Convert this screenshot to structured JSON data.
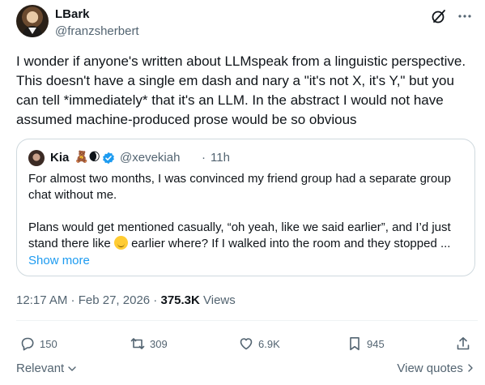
{
  "author": {
    "display_name": "LBark",
    "handle": "@franzsherbert"
  },
  "icons": {
    "grok": "grok-icon",
    "more": "more-horizontal-icon"
  },
  "tweet": {
    "text": "I wonder if anyone's written about LLMspeak from a linguistic perspective. This doesn't have a single em dash and nary a \"it's not X, it's Y,\" but you can tell *immediately* that it's an LLM. In the abstract I would not have assumed machine-produced prose would be so obvious"
  },
  "quote": {
    "name": "Kia",
    "name_emoji": "🧸🌒",
    "handle": "@xevekiah",
    "separator": "·",
    "time": "11h",
    "text_line1": "For almost two months, I was convinced my friend group had a separate group chat without me.",
    "text_line2a": "Plans would get mentioned casually, “oh yeah, like we said earlier”, and I’d just stand there like ",
    "text_line2b": " earlier where? If I walked into the room and they stopped ...",
    "show_more": "Show more"
  },
  "meta": {
    "time": "12:17 AM",
    "sep1": " · ",
    "date": "Feb 27, 2026",
    "sep2": " · ",
    "views_count": "375.3K",
    "views_label": " Views"
  },
  "actions": {
    "replies": "150",
    "reposts": "309",
    "likes": "6.9K",
    "bookmarks": "945"
  },
  "footer": {
    "relevant": "Relevant",
    "view_quotes": "View quotes"
  },
  "colors": {
    "accent": "#1d9bf0",
    "secondary_text": "#536471",
    "border": "#cfd9de"
  }
}
